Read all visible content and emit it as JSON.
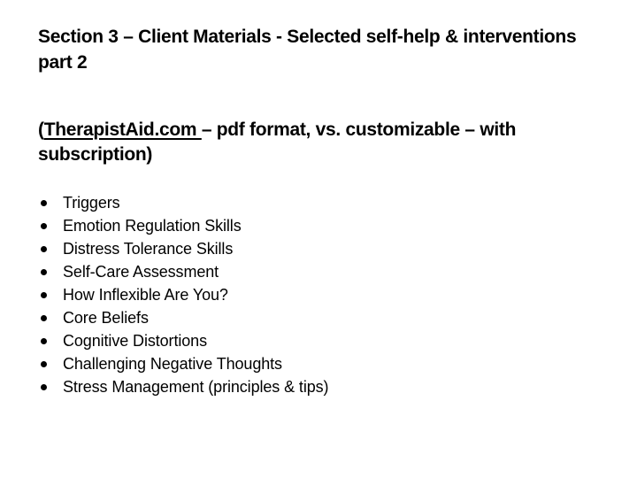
{
  "title": "Section 3 – Client Materials - Selected self-help & interventions part 2",
  "subtitle": {
    "open_paren": "(",
    "link_text": "TherapistAid.com ",
    "rest": "– pdf format, vs. customizable – with subscription)"
  },
  "items": [
    {
      "label": "Triggers",
      "icon": "bullet-icon"
    },
    {
      "label": "Emotion Regulation Skills",
      "icon": "bullet-icon"
    },
    {
      "label": "Distress Tolerance Skills",
      "icon": "bullet-icon"
    },
    {
      "label": "Self-Care Assessment",
      "icon": "bullet-icon"
    },
    {
      "label": "How Inflexible Are You?",
      "icon": "bullet-icon"
    },
    {
      "label": "Core Beliefs",
      "icon": "bullet-icon"
    },
    {
      "label": "Cognitive Distortions",
      "icon": "bullet-icon"
    },
    {
      "label": "Challenging Negative Thoughts",
      "icon": "bullet-icon"
    },
    {
      "label": "Stress Management (principles & tips)",
      "icon": "bullet-icon"
    }
  ]
}
